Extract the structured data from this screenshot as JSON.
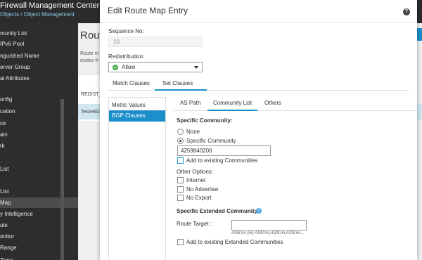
{
  "app": {
    "title": "Firewall Management Center",
    "breadcrumb": "Objects / Object Management",
    "sidebar": [
      "munity List",
      "IPv6 Pool",
      "nguished Name",
      "erver Group",
      "al Attributes",
      "onfig",
      "cation",
      "ce",
      "ain",
      "rk",
      "List",
      "List",
      "Map",
      "y Intelligence",
      "ule",
      "onitor",
      "Range",
      "Zone"
    ],
    "sidebar_active_index": 12,
    "page_title": "Route",
    "page_desc": [
      "Route m",
      "routes fr"
    ],
    "table_rows": [
      "REDIST_",
      "TesteBG"
    ]
  },
  "modal": {
    "title": "Edit Route Map Entry",
    "help_icon": "help-icon",
    "sequence_label": "Sequence No:",
    "sequence_value": "10",
    "redistribution_label": "Redistribution:",
    "redistribution_value": "Allow",
    "tabs": [
      "Match Clauses",
      "Set Clauses"
    ],
    "active_tab": "Set Clauses",
    "left_items": [
      "Metric Values",
      "BGP Clauses"
    ],
    "active_left_item": "BGP Clauses",
    "sub_tabs": [
      "AS Path",
      "Community List",
      "Others"
    ],
    "active_sub_tab": "Community List",
    "specific_community": {
      "title": "Specific Community:",
      "option_none": "None",
      "option_specific": "Specific Community",
      "selected": "Specific Community",
      "value": "4259840200",
      "add_existing": "Add to existing Communities"
    },
    "other_options": {
      "title": "Other Options:",
      "internet": "Internet",
      "no_advertise": "No Advertise",
      "no_export": "No Export"
    },
    "extended": {
      "title": "Specific Extended Community:",
      "route_target_label": "Route Target :",
      "route_target_hint": "ASN:nn (or) ASN:nn,ASN:nn,ASN:nn...",
      "add_existing": "Add to existing Extended Communities"
    }
  },
  "colors": {
    "accent": "#1b8fc9",
    "allow_green": "#4caf50",
    "sidebar_bg": "#2d2d2d"
  }
}
